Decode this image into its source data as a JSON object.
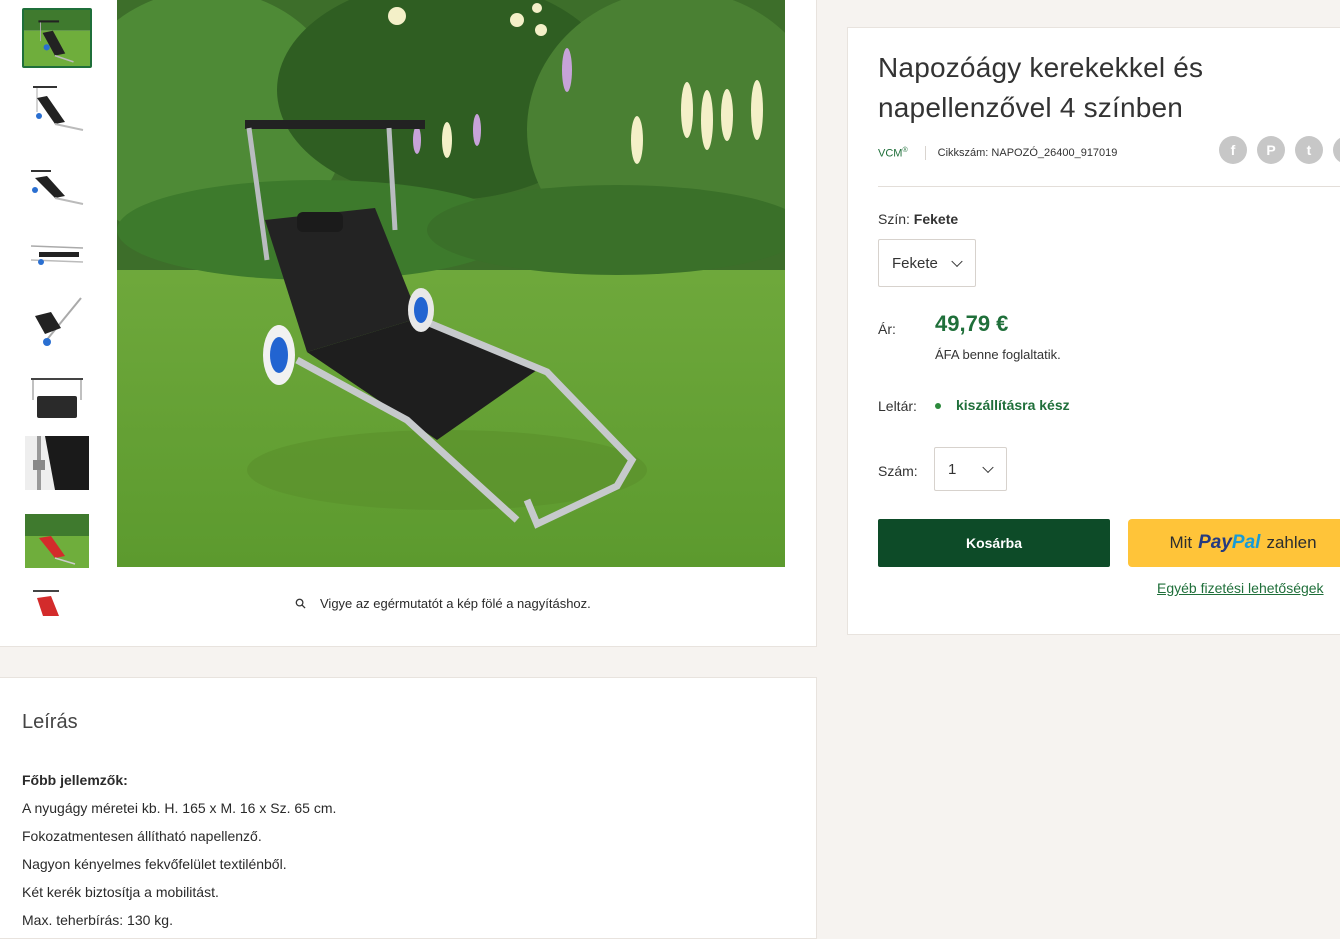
{
  "gallery": {
    "thumbnail_count": 9,
    "active_thumbnail": 0,
    "zoom_hint": "Vigye az egérmutatót a kép fölé a nagyításhoz."
  },
  "product": {
    "title": "Napozóágy kerekekkel és napellenzővel 4 színben",
    "vendor": "VCM",
    "vendor_mark": "®",
    "sku_label": "Cikkszám:",
    "sku": "NAPOZÓ_26400_917019",
    "share_icons": [
      "facebook-icon",
      "pinterest-icon",
      "twitter-icon",
      "email-icon"
    ],
    "share_glyphs": [
      "f",
      "P",
      "t",
      "@"
    ],
    "color_label": "Szín:",
    "color_value": "Fekete",
    "color_selected": "Fekete",
    "price_label": "Ár:",
    "price": "49,79 €",
    "tax_note": "ÁFA benne foglaltatik.",
    "stock_label": "Leltár:",
    "stock_status": "kiszállításra kész",
    "qty_label": "Szám:",
    "qty_value": "1",
    "add_to_cart": "Kosárba",
    "paypal_prefix": "Mit",
    "paypal_brand_1": "Pay",
    "paypal_brand_2": "Pal",
    "paypal_suffix": "zahlen",
    "more_payment": "Egyéb fizetési lehetőségek"
  },
  "description": {
    "title": "Leírás",
    "heading": "Főbb jellemzők:",
    "lines": [
      "A nyugágy méretei kb. H. 165 x M. 16 x Sz. 65 cm.",
      "Fokozatmentesen állítható napellenző.",
      "Nagyon kényelmes fekvőfelület textilénből.",
      "Két kerék biztosítja a mobilitást.",
      "Max. teherbírás: 130 kg."
    ]
  },
  "colors": {
    "accent": "#1f6f3a",
    "cart_button": "#0d4b28",
    "paypal_yellow": "#ffc439",
    "page_bg": "#f6f3f0"
  }
}
